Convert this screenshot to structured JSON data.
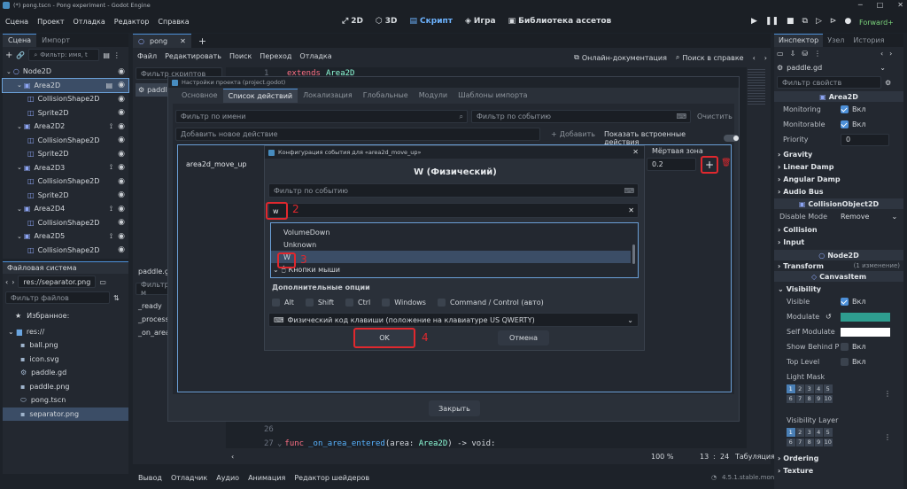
{
  "window": {
    "title": "(*) pong.tscn - Pong experiment - Godot Engine"
  },
  "menubar": {
    "items": [
      "Сцена",
      "Проект",
      "Отладка",
      "Редактор",
      "Справка"
    ]
  },
  "main_tabs": {
    "t2d": "2D",
    "t3d": "3D",
    "script": "Скрипт",
    "game": "Игра",
    "assets": "Библиотека ассетов"
  },
  "renderer": "Forward+",
  "scene_dock": {
    "tab_scene": "Сцена",
    "tab_import": "Импорт",
    "filter_placeholder": "Фильтр: имя, t",
    "nodes": [
      {
        "label": "Node2D",
        "depth": 0
      },
      {
        "label": "Area2D",
        "depth": 1
      },
      {
        "label": "CollisionShape2D",
        "depth": 2
      },
      {
        "label": "Sprite2D",
        "depth": 2
      },
      {
        "label": "Area2D2",
        "depth": 1
      },
      {
        "label": "CollisionShape2D",
        "depth": 2
      },
      {
        "label": "Sprite2D",
        "depth": 2
      },
      {
        "label": "Area2D3",
        "depth": 1
      },
      {
        "label": "CollisionShape2D",
        "depth": 2
      },
      {
        "label": "Sprite2D",
        "depth": 2
      },
      {
        "label": "Area2D4",
        "depth": 1
      },
      {
        "label": "CollisionShape2D",
        "depth": 2
      },
      {
        "label": "Area2D5",
        "depth": 1
      },
      {
        "label": "CollisionShape2D",
        "depth": 2
      }
    ]
  },
  "filesystem": {
    "title": "Файловая система",
    "path": "res://separator.png",
    "filter_placeholder": "Фильтр файлов",
    "favorites": "Избранное:",
    "root": "res://",
    "files": [
      "ball.png",
      "icon.svg",
      "paddle.gd",
      "paddle.png",
      "pong.tscn",
      "separator.png"
    ]
  },
  "script_editor": {
    "tab": "pong",
    "menu": [
      "Файл",
      "Редактировать",
      "Поиск",
      "Переход",
      "Отладка"
    ],
    "online_docs": "Онлайн-документация",
    "help_search": "Поиск в справке",
    "filter_scripts": "Фильтр скриптов",
    "script_item": "paddle",
    "method_file": "paddle.gd",
    "method_filter": "Фильтр м",
    "methods": [
      "_ready",
      "_process",
      "_on_area_"
    ],
    "line1_num": "1",
    "line1_kw": "extends",
    "line1_cls": "Area2D",
    "line26_num": "26",
    "line27_num": "27",
    "line27_kw": "func",
    "line27_name": "_on_area_entered",
    "line27_args": "(area: ",
    "line27_type": "Area2D",
    "line27_rest": ") -> void:",
    "zoom": "100 %",
    "line_pos": "13",
    "col_pos": "24",
    "indent": "Табуляция"
  },
  "bottom_panel": {
    "tabs": [
      "Вывод",
      "Отладчик",
      "Аудио",
      "Анимация",
      "Редактор шейдеров"
    ],
    "version": "4.5.1.stable.mono"
  },
  "project_settings": {
    "title": "Настройки проекта (project.godot)",
    "tabs": [
      "Основное",
      "Список действий",
      "Локализация",
      "Глобальные",
      "Модули",
      "Шаблоны импорта"
    ],
    "filter_name": "Фильтр по имени",
    "filter_event": "Фильтр по событию",
    "clear": "Очистить",
    "add_action_placeholder": "Добавить новое действие",
    "add": "Добавить",
    "show_builtin": "Показать встроенные действия",
    "deadzone_header": "Мёртвая зона",
    "action": "area2d_move_up",
    "deadzone": "0.2",
    "close": "Закрыть"
  },
  "event_dialog": {
    "title": "Конфигурация события для «area2d_move_up»",
    "heading": "W (Физический)",
    "filter_event": "Фильтр по событию",
    "search_value": "w",
    "list": [
      "VolumeDown",
      "Unknown",
      "W",
      "Кнопки мыши"
    ],
    "options_title": "Дополнительные опции",
    "mods": [
      "Alt",
      "Shift",
      "Ctrl",
      "Windows",
      "Command / Control (авто)"
    ],
    "keycode": "Физический код клавиши (положение на клавиатуре US QWERTY)",
    "ok": "OK",
    "cancel": "Отмена"
  },
  "annotations": [
    "2",
    "3",
    "4"
  ],
  "inspector": {
    "tab_inspector": "Инспектор",
    "tab_node": "Узел",
    "tab_history": "История",
    "resource": "paddle.gd",
    "filter_placeholder": "Фильтр свойств",
    "area2d": "Area2D",
    "monitoring": "Monitoring",
    "monitorable": "Monitorable",
    "on": "Вкл",
    "priority": "Priority",
    "priority_val": "0",
    "groups": [
      "Gravity",
      "Linear Damp",
      "Angular Damp",
      "Audio Bus"
    ],
    "collision_object": "CollisionObject2D",
    "disable_mode": "Disable Mode",
    "disable_mode_val": "Remove",
    "collision": "Collision",
    "input": "Input",
    "node2d": "Node2D",
    "transform": "Transform",
    "transform_changes": "(1 изменение)",
    "canvas_item": "CanvasItem",
    "visibility": "Visibility",
    "visible": "Visible",
    "modulate": "Modulate",
    "self_modulate": "Self Modulate",
    "show_behind": "Show Behind P",
    "top_level": "Top Level",
    "light_mask": "Light Mask",
    "visibility_layer": "Visibility Layer",
    "ordering": "Ordering",
    "texture": "Texture",
    "layers_row1": [
      "1",
      "2",
      "3",
      "4",
      "5"
    ],
    "layers_row2": [
      "6",
      "7",
      "8",
      "9",
      "10"
    ],
    "modulate_color": "#2e9d8f"
  },
  "colors": {
    "accent": "#4d90d9",
    "annotation": "#e0282e"
  }
}
